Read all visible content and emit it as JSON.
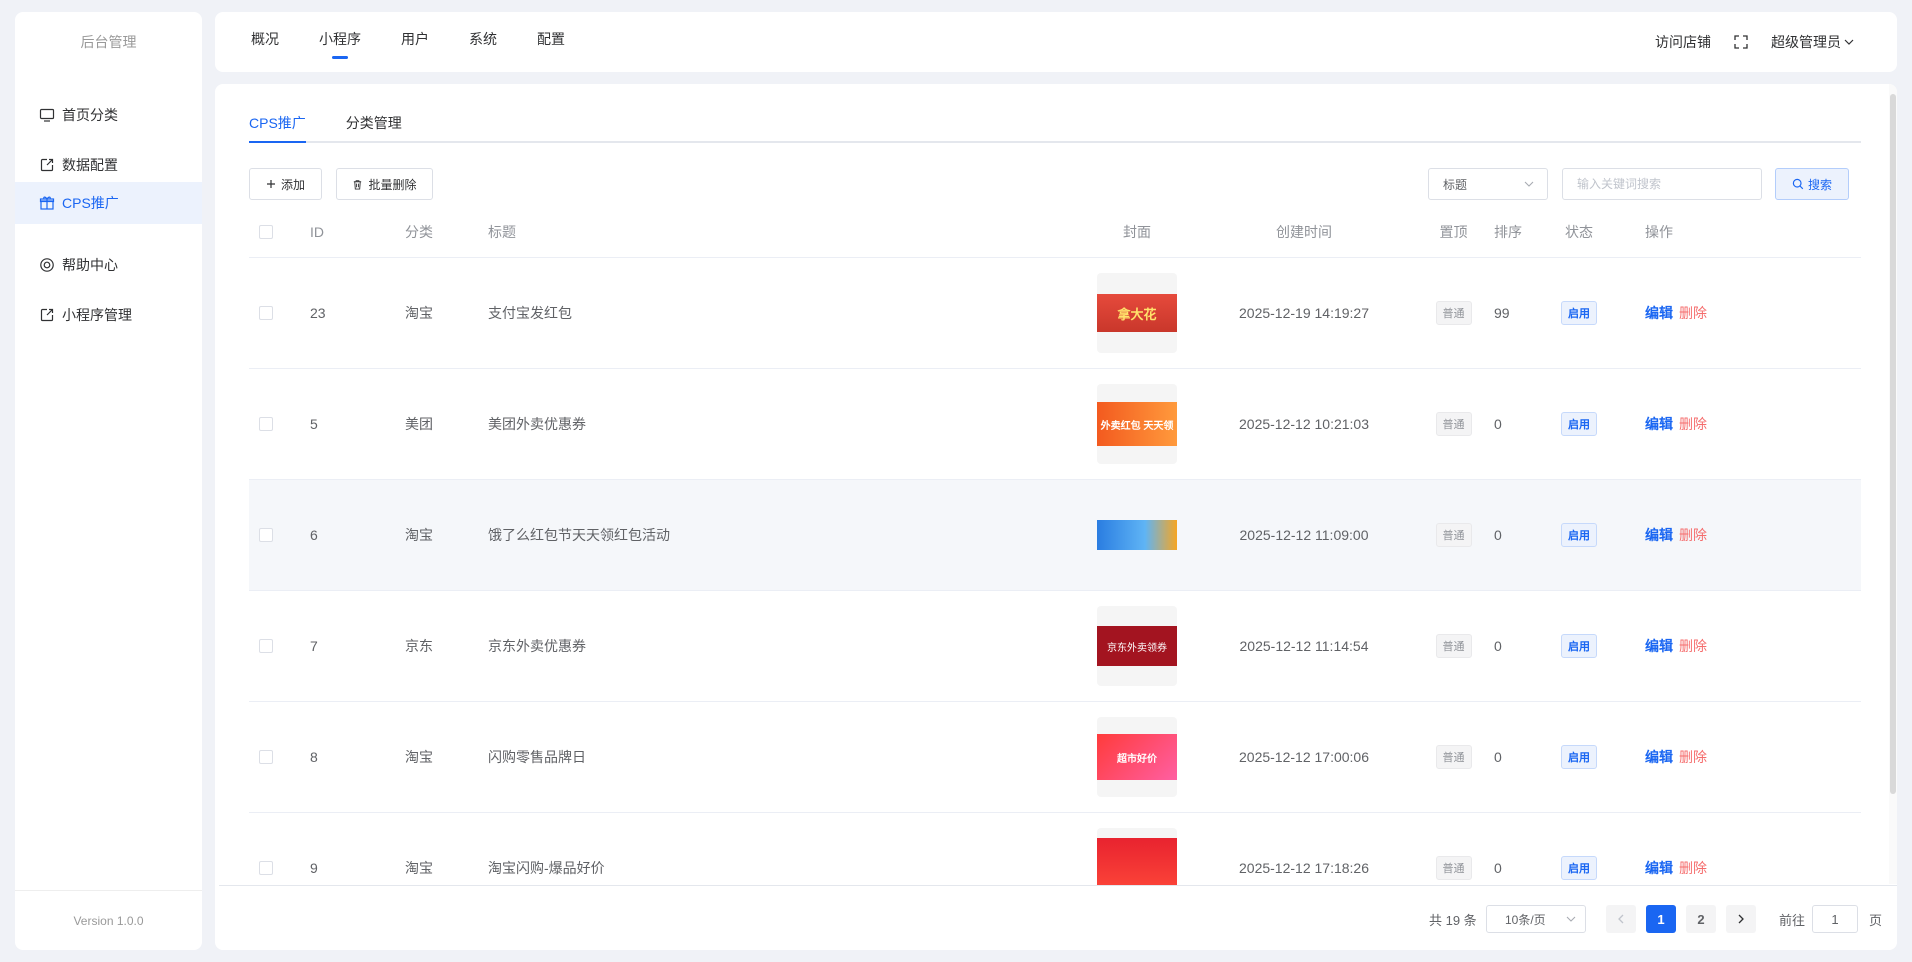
{
  "sidebar": {
    "brand": "后台管理",
    "items": [
      {
        "label": "首页分类",
        "icon": "monitor-icon"
      },
      {
        "label": "数据配置",
        "icon": "external-link-icon"
      },
      {
        "label": "CPS推广",
        "icon": "gift-icon",
        "active": true
      },
      {
        "label": "帮助中心",
        "icon": "lifebuoy-icon"
      },
      {
        "label": "小程序管理",
        "icon": "external-link-icon"
      }
    ],
    "version": "Version 1.0.0"
  },
  "topnav": {
    "items": [
      "概况",
      "小程序",
      "用户",
      "系统",
      "配置"
    ],
    "active_index": 1,
    "visit_store": "访问店铺",
    "admin": "超级管理员"
  },
  "tabs": [
    "CPS推广",
    "分类管理"
  ],
  "toolbar": {
    "add_label": "添加",
    "batch_delete_label": "批量删除",
    "filter_field": "标题",
    "search_placeholder": "输入关键词搜索",
    "search_label": "搜索"
  },
  "table": {
    "headers": {
      "id": "ID",
      "category": "分类",
      "title": "标题",
      "cover": "封面",
      "created": "创建时间",
      "pinned": "置顶",
      "sort": "排序",
      "status": "状态",
      "ops": "操作"
    },
    "rows": [
      {
        "id": "23",
        "category": "淘宝",
        "title": "支付宝发红包",
        "cover_text": "拿大花",
        "created": "2025-12-19 14:19:27",
        "pinned": "普通",
        "sort": "99",
        "status": "启用",
        "edit": "编辑",
        "delete": "删除"
      },
      {
        "id": "5",
        "category": "美团",
        "title": "美团外卖优惠券",
        "cover_text": "外卖红包 天天领",
        "created": "2025-12-12 10:21:03",
        "pinned": "普通",
        "sort": "0",
        "status": "启用",
        "edit": "编辑",
        "delete": "删除"
      },
      {
        "id": "6",
        "category": "淘宝",
        "title": "饿了么红包节天天领红包活动",
        "cover_text": "",
        "created": "2025-12-12 11:09:00",
        "pinned": "普通",
        "sort": "0",
        "status": "启用",
        "edit": "编辑",
        "delete": "删除"
      },
      {
        "id": "7",
        "category": "京东",
        "title": "京东外卖优惠券",
        "cover_text": "京东外卖领券",
        "created": "2025-12-12 11:14:54",
        "pinned": "普通",
        "sort": "0",
        "status": "启用",
        "edit": "编辑",
        "delete": "删除"
      },
      {
        "id": "8",
        "category": "淘宝",
        "title": "闪购零售品牌日",
        "cover_text": "超市好价",
        "created": "2025-12-12 17:00:06",
        "pinned": "普通",
        "sort": "0",
        "status": "启用",
        "edit": "编辑",
        "delete": "删除"
      },
      {
        "id": "9",
        "category": "淘宝",
        "title": "淘宝闪购-爆品好价",
        "cover_text": "",
        "created": "2025-12-12 17:18:26",
        "pinned": "普通",
        "sort": "0",
        "status": "启用",
        "edit": "编辑",
        "delete": "删除"
      }
    ]
  },
  "pagination": {
    "total": "共 19 条",
    "page_size": "10条/页",
    "pages": [
      "1",
      "2"
    ],
    "current": "1",
    "goto_label": "前往",
    "goto_value": "1",
    "page_suffix": "页"
  },
  "colors": {
    "accent": "#1a66f2",
    "danger": "#f56c6c",
    "background": "#f0f2f7"
  }
}
